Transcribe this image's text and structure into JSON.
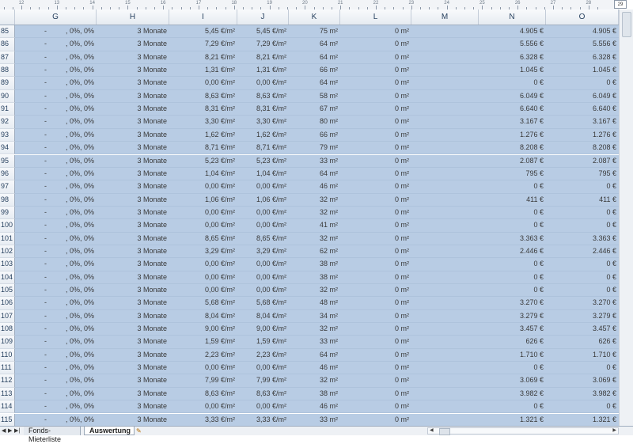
{
  "ruler": {
    "labels": [
      "12",
      "13",
      "14",
      "15",
      "16",
      "17",
      "18",
      "19",
      "20",
      "21",
      "22",
      "23",
      "24",
      "25",
      "26",
      "27",
      "28"
    ],
    "end_label": "29"
  },
  "columns": [
    "G",
    "H",
    "I",
    "J",
    "K",
    "L",
    "M",
    "N",
    "O"
  ],
  "rows": [
    {
      "num": "85",
      "g1": "-",
      "g2": ", 0%, 0%",
      "h": "3 Monate",
      "i": "5,45 €/m²",
      "j": "5,45 €/m²",
      "k": "75 m²",
      "l": "0 m²",
      "n": "4.905 €",
      "o": "4.905 €"
    },
    {
      "num": "86",
      "g1": "-",
      "g2": ", 0%, 0%",
      "h": "3 Monate",
      "i": "7,29 €/m²",
      "j": "7,29 €/m²",
      "k": "64 m²",
      "l": "0 m²",
      "n": "5.556 €",
      "o": "5.556 €"
    },
    {
      "num": "87",
      "g1": "-",
      "g2": ", 0%, 0%",
      "h": "3 Monate",
      "i": "8,21 €/m²",
      "j": "8,21 €/m²",
      "k": "64 m²",
      "l": "0 m²",
      "n": "6.328 €",
      "o": "6.328 €"
    },
    {
      "num": "88",
      "g1": "-",
      "g2": ", 0%, 0%",
      "h": "3 Monate",
      "i": "1,31 €/m²",
      "j": "1,31 €/m²",
      "k": "66 m²",
      "l": "0 m²",
      "n": "1.045 €",
      "o": "1.045 €"
    },
    {
      "num": "89",
      "g1": "-",
      "g2": ", 0%, 0%",
      "h": "3 Monate",
      "i": "0,00 €/m²",
      "j": "0,00 €/m²",
      "k": "64 m²",
      "l": "0 m²",
      "n": "0 €",
      "o": "0 €"
    },
    {
      "num": "90",
      "g1": "-",
      "g2": ", 0%, 0%",
      "h": "3 Monate",
      "i": "8,63 €/m²",
      "j": "8,63 €/m²",
      "k": "58 m²",
      "l": "0 m²",
      "n": "6.049 €",
      "o": "6.049 €"
    },
    {
      "num": "91",
      "g1": "-",
      "g2": ", 0%, 0%",
      "h": "3 Monate",
      "i": "8,31 €/m²",
      "j": "8,31 €/m²",
      "k": "67 m²",
      "l": "0 m²",
      "n": "6.640 €",
      "o": "6.640 €"
    },
    {
      "num": "92",
      "g1": "-",
      "g2": ", 0%, 0%",
      "h": "3 Monate",
      "i": "3,30 €/m²",
      "j": "3,30 €/m²",
      "k": "80 m²",
      "l": "0 m²",
      "n": "3.167 €",
      "o": "3.167 €"
    },
    {
      "num": "93",
      "g1": "-",
      "g2": ", 0%, 0%",
      "h": "3 Monate",
      "i": "1,62 €/m²",
      "j": "1,62 €/m²",
      "k": "66 m²",
      "l": "0 m²",
      "n": "1.276 €",
      "o": "1.276 €"
    },
    {
      "num": "94",
      "g1": "-",
      "g2": ", 0%, 0%",
      "h": "3 Monate",
      "i": "8,71 €/m²",
      "j": "8,71 €/m²",
      "k": "79 m²",
      "l": "0 m²",
      "n": "8.208 €",
      "o": "8.208 €"
    },
    {
      "num": "95",
      "g1": "-",
      "g2": ", 0%, 0%",
      "h": "3 Monate",
      "i": "5,23 €/m²",
      "j": "5,23 €/m²",
      "k": "33 m²",
      "l": "0 m²",
      "n": "2.087 €",
      "o": "2.087 €"
    },
    {
      "num": "96",
      "g1": "-",
      "g2": ", 0%, 0%",
      "h": "3 Monate",
      "i": "1,04 €/m²",
      "j": "1,04 €/m²",
      "k": "64 m²",
      "l": "0 m²",
      "n": "795 €",
      "o": "795 €"
    },
    {
      "num": "97",
      "g1": "-",
      "g2": ", 0%, 0%",
      "h": "3 Monate",
      "i": "0,00 €/m²",
      "j": "0,00 €/m²",
      "k": "46 m²",
      "l": "0 m²",
      "n": "0 €",
      "o": "0 €"
    },
    {
      "num": "98",
      "g1": "-",
      "g2": ", 0%, 0%",
      "h": "3 Monate",
      "i": "1,06 €/m²",
      "j": "1,06 €/m²",
      "k": "32 m²",
      "l": "0 m²",
      "n": "411 €",
      "o": "411 €"
    },
    {
      "num": "99",
      "g1": "-",
      "g2": ", 0%, 0%",
      "h": "3 Monate",
      "i": "0,00 €/m²",
      "j": "0,00 €/m²",
      "k": "32 m²",
      "l": "0 m²",
      "n": "0 €",
      "o": "0 €"
    },
    {
      "num": "100",
      "g1": "-",
      "g2": ", 0%, 0%",
      "h": "3 Monate",
      "i": "0,00 €/m²",
      "j": "0,00 €/m²",
      "k": "41 m²",
      "l": "0 m²",
      "n": "0 €",
      "o": "0 €"
    },
    {
      "num": "101",
      "g1": "-",
      "g2": ", 0%, 0%",
      "h": "3 Monate",
      "i": "8,65 €/m²",
      "j": "8,65 €/m²",
      "k": "32 m²",
      "l": "0 m²",
      "n": "3.363 €",
      "o": "3.363 €"
    },
    {
      "num": "102",
      "g1": "-",
      "g2": ", 0%, 0%",
      "h": "3 Monate",
      "i": "3,29 €/m²",
      "j": "3,29 €/m²",
      "k": "62 m²",
      "l": "0 m²",
      "n": "2.446 €",
      "o": "2.446 €"
    },
    {
      "num": "103",
      "g1": "-",
      "g2": ", 0%, 0%",
      "h": "3 Monate",
      "i": "0,00 €/m²",
      "j": "0,00 €/m²",
      "k": "38 m²",
      "l": "0 m²",
      "n": "0 €",
      "o": "0 €"
    },
    {
      "num": "104",
      "g1": "-",
      "g2": ", 0%, 0%",
      "h": "3 Monate",
      "i": "0,00 €/m²",
      "j": "0,00 €/m²",
      "k": "38 m²",
      "l": "0 m²",
      "n": "0 €",
      "o": "0 €"
    },
    {
      "num": "105",
      "g1": "-",
      "g2": ", 0%, 0%",
      "h": "3 Monate",
      "i": "0,00 €/m²",
      "j": "0,00 €/m²",
      "k": "32 m²",
      "l": "0 m²",
      "n": "0 €",
      "o": "0 €"
    },
    {
      "num": "106",
      "g1": "-",
      "g2": ", 0%, 0%",
      "h": "3 Monate",
      "i": "5,68 €/m²",
      "j": "5,68 €/m²",
      "k": "48 m²",
      "l": "0 m²",
      "n": "3.270 €",
      "o": "3.270 €"
    },
    {
      "num": "107",
      "g1": "-",
      "g2": ", 0%, 0%",
      "h": "3 Monate",
      "i": "8,04 €/m²",
      "j": "8,04 €/m²",
      "k": "34 m²",
      "l": "0 m²",
      "n": "3.279 €",
      "o": "3.279 €"
    },
    {
      "num": "108",
      "g1": "-",
      "g2": ", 0%, 0%",
      "h": "3 Monate",
      "i": "9,00 €/m²",
      "j": "9,00 €/m²",
      "k": "32 m²",
      "l": "0 m²",
      "n": "3.457 €",
      "o": "3.457 €"
    },
    {
      "num": "109",
      "g1": "-",
      "g2": ", 0%, 0%",
      "h": "3 Monate",
      "i": "1,59 €/m²",
      "j": "1,59 €/m²",
      "k": "33 m²",
      "l": "0 m²",
      "n": "626 €",
      "o": "626 €"
    },
    {
      "num": "110",
      "g1": "-",
      "g2": ", 0%, 0%",
      "h": "3 Monate",
      "i": "2,23 €/m²",
      "j": "2,23 €/m²",
      "k": "64 m²",
      "l": "0 m²",
      "n": "1.710 €",
      "o": "1.710 €"
    },
    {
      "num": "111",
      "g1": "-",
      "g2": ", 0%, 0%",
      "h": "3 Monate",
      "i": "0,00 €/m²",
      "j": "0,00 €/m²",
      "k": "46 m²",
      "l": "0 m²",
      "n": "0 €",
      "o": "0 €"
    },
    {
      "num": "112",
      "g1": "-",
      "g2": ", 0%, 0%",
      "h": "3 Monate",
      "i": "7,99 €/m²",
      "j": "7,99 €/m²",
      "k": "32 m²",
      "l": "0 m²",
      "n": "3.069 €",
      "o": "3.069 €"
    },
    {
      "num": "113",
      "g1": "-",
      "g2": ", 0%, 0%",
      "h": "3 Monate",
      "i": "8,63 €/m²",
      "j": "8,63 €/m²",
      "k": "38 m²",
      "l": "0 m²",
      "n": "3.982 €",
      "o": "3.982 €"
    },
    {
      "num": "114",
      "g1": "-",
      "g2": ", 0%, 0%",
      "h": "3 Monate",
      "i": "0,00 €/m²",
      "j": "0,00 €/m²",
      "k": "46 m²",
      "l": "0 m²",
      "n": "0 €",
      "o": "0 €"
    },
    {
      "num": "115",
      "g1": "-",
      "g2": ", 0%, 0%",
      "h": "3 Monate",
      "i": "3,33 €/m²",
      "j": "3,33 €/m²",
      "k": "33 m²",
      "l": "0 m²",
      "n": "1.321 €",
      "o": "1.321 €"
    }
  ],
  "sheet_tabs": [
    "Fonds-Mieterliste",
    "Auswertung"
  ],
  "active_tab": "Auswertung",
  "colors": {
    "selection_fill": "#b8cce4",
    "header_text": "#27415f"
  }
}
